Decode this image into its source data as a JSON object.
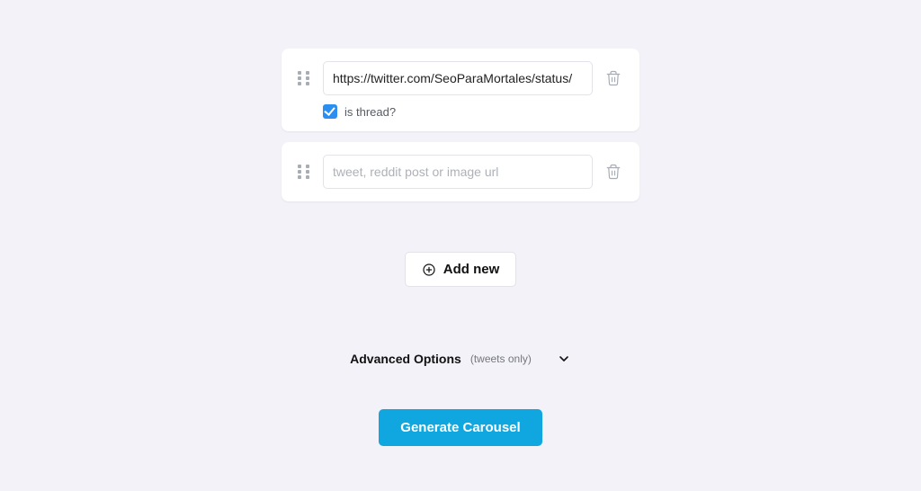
{
  "inputs": [
    {
      "value": "https://twitter.com/SeoParaMortales/status/",
      "placeholder": "",
      "is_thread": true
    },
    {
      "value": "",
      "placeholder": "tweet, reddit post or image url",
      "is_thread": null
    }
  ],
  "thread_label": "is thread?",
  "add_new_label": "Add new",
  "advanced": {
    "title": "Advanced Options",
    "subtitle": "(tweets only)"
  },
  "generate_label": "Generate Carousel"
}
